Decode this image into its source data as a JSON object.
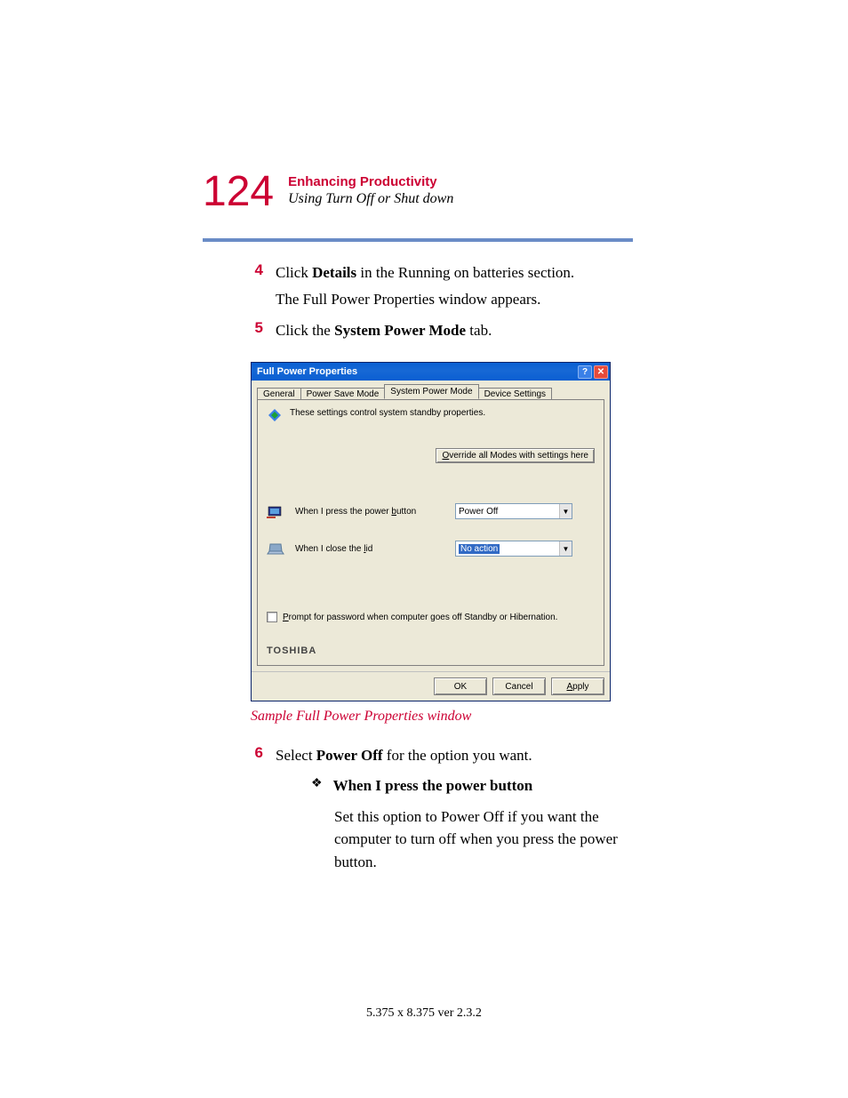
{
  "page_number": "124",
  "chapter_title": "Enhancing Productivity",
  "section_title": "Using Turn Off or Shut down",
  "steps": {
    "4": {
      "num": "4",
      "line1_a": "Click ",
      "line1_b": "Details",
      "line1_c": " in the Running on batteries section.",
      "line2": "The Full Power Properties window appears."
    },
    "5": {
      "num": "5",
      "a": "Click the ",
      "b": "System Power Mode",
      "c": " tab."
    },
    "6": {
      "num": "6",
      "a": "Select ",
      "b": "Power Off",
      "c": " for the option you want."
    }
  },
  "dialog": {
    "title": "Full Power Properties",
    "tabs": {
      "general": "General",
      "power_save": "Power Save Mode",
      "system_power": "System Power Mode",
      "device_settings": "Device Settings"
    },
    "description": "These settings control system standby properties.",
    "override_btn_a": "O",
    "override_btn_b": "verride all Modes with settings here",
    "power_btn_label_a": "When I press the power ",
    "power_btn_label_b": "b",
    "power_btn_label_c": "utton",
    "power_btn_value": "Power Off",
    "lid_label_a": "When I close the ",
    "lid_label_b": "l",
    "lid_label_c": "id",
    "lid_value": "No action",
    "checkbox_a": "P",
    "checkbox_b": "rompt for password when computer goes off Standby or Hibernation.",
    "brand": "TOSHIBA",
    "ok": "OK",
    "cancel": "Cancel",
    "apply_a": "A",
    "apply_b": "pply"
  },
  "caption": "Sample Full Power Properties window",
  "bullet": {
    "glyph": "❖",
    "title": "When I press the power button",
    "para": "Set this option to Power Off if you want the computer to turn off when you press the power button."
  },
  "footer": "5.375 x 8.375 ver 2.3.2"
}
